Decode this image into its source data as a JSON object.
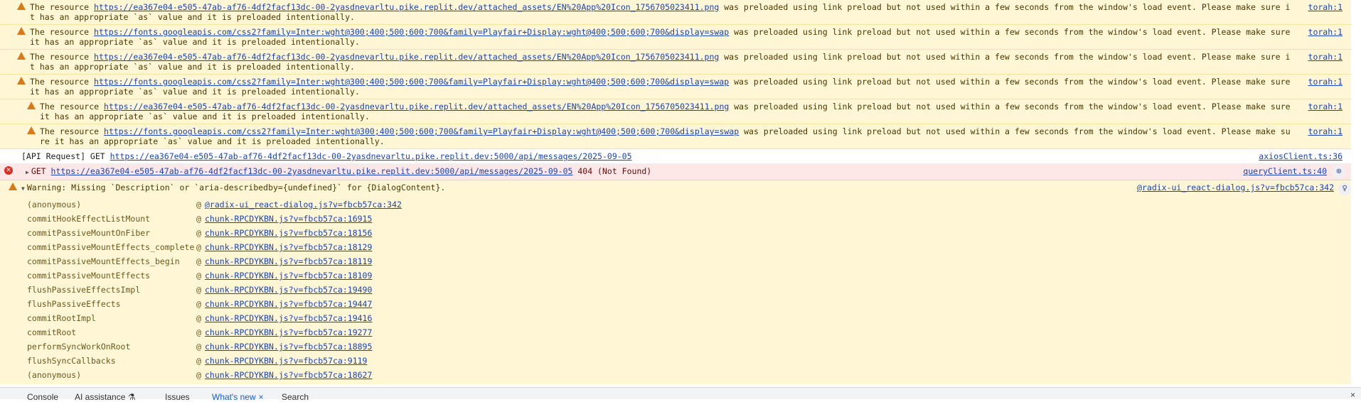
{
  "preload_warnings": [
    {
      "prefix": "The resource ",
      "url": "https://ea367e04-e505-47ab-af76-4df2facf13dc-00-2yasdnevarltu.pike.replit.dev/attached_assets/EN%20App%20Icon_1756705023411.png",
      "suffix": " was preloaded using link preload but not used within a few seconds from the window's load event. Please make sure it has an appropriate `as` value and it is preloaded intentionally.",
      "source": "torah:1",
      "nested": false
    },
    {
      "prefix": "The resource ",
      "url": "https://fonts.googleapis.com/css2?family=Inter:wght@300;400;500;600;700&family=Playfair+Display:wght@400;500;600;700&display=swap",
      "suffix": " was preloaded using link preload but not used within a few seconds from the window's load event. Please make sure it has an appropriate `as` value and it is preloaded intentionally.",
      "source": "torah:1",
      "nested": false
    },
    {
      "prefix": "The resource ",
      "url": "https://ea367e04-e505-47ab-af76-4df2facf13dc-00-2yasdnevarltu.pike.replit.dev/attached_assets/EN%20App%20Icon_1756705023411.png",
      "suffix": " was preloaded using link preload but not used within a few seconds from the window's load event. Please make sure it has an appropriate `as` value and it is preloaded intentionally.",
      "source": "torah:1",
      "nested": false
    },
    {
      "prefix": "The resource ",
      "url": "https://fonts.googleapis.com/css2?family=Inter:wght@300;400;500;600;700&family=Playfair+Display:wght@400;500;600;700&display=swap",
      "suffix": " was preloaded using link preload but not used within a few seconds from the window's load event. Please make sure it has an appropriate `as` value and it is preloaded intentionally.",
      "source": "torah:1",
      "nested": false
    },
    {
      "prefix": "The resource ",
      "url": "https://ea367e04-e505-47ab-af76-4df2facf13dc-00-2yasdnevarltu.pike.replit.dev/attached_assets/EN%20App%20Icon_1756705023411.png",
      "suffix": " was preloaded using link preload but not used within a few seconds from the window's load event. Please make sure it has an appropriate `as` value and it is preloaded intentionally.",
      "source": "torah:1",
      "nested": true
    },
    {
      "prefix": "The resource ",
      "url": "https://fonts.googleapis.com/css2?family=Inter:wght@300;400;500;600;700&family=Playfair+Display:wght@400;500;600;700&display=swap",
      "suffix": " was preloaded using link preload but not used within a few seconds from the window's load event. Please make sure it has an appropriate `as` value and it is preloaded intentionally.",
      "source": "torah:1",
      "nested": true
    }
  ],
  "api_log": {
    "prefix": "[API Request] GET ",
    "url": "https://ea367e04-e505-47ab-af76-4df2facf13dc-00-2yasdnevarltu.pike.replit.dev:5000/api/messages/2025-09-05",
    "source": "axiosClient.ts:36"
  },
  "error_row": {
    "method": "GET ",
    "url": "https://ea367e04-e505-47ab-af76-4df2facf13dc-00-2yasdnevarltu.pike.replit.dev:5000/api/messages/2025-09-05",
    "status": " 404 (Not Found)",
    "source": "queryClient.ts:40",
    "ai_glyph": "⊕"
  },
  "dialog_warning": {
    "text": "Warning: Missing `Description` or `aria-describedby={undefined}` for {DialogContent}.",
    "source": "@radix-ui_react-dialog.js?v=fbcb57ca:342",
    "insight_glyph": "♀"
  },
  "stack_frames": [
    {
      "fn": "(anonymous)",
      "loc": "@radix-ui_react-dialog.js?v=fbcb57ca:342"
    },
    {
      "fn": "commitHookEffectListMount",
      "loc": "chunk-RPCDYKBN.js?v=fbcb57ca:16915"
    },
    {
      "fn": "commitPassiveMountOnFiber",
      "loc": "chunk-RPCDYKBN.js?v=fbcb57ca:18156"
    },
    {
      "fn": "commitPassiveMountEffects_complete",
      "loc": "chunk-RPCDYKBN.js?v=fbcb57ca:18129"
    },
    {
      "fn": "commitPassiveMountEffects_begin",
      "loc": "chunk-RPCDYKBN.js?v=fbcb57ca:18119"
    },
    {
      "fn": "commitPassiveMountEffects",
      "loc": "chunk-RPCDYKBN.js?v=fbcb57ca:18109"
    },
    {
      "fn": "flushPassiveEffectsImpl",
      "loc": "chunk-RPCDYKBN.js?v=fbcb57ca:19490"
    },
    {
      "fn": "flushPassiveEffects",
      "loc": "chunk-RPCDYKBN.js?v=fbcb57ca:19447"
    },
    {
      "fn": "commitRootImpl",
      "loc": "chunk-RPCDYKBN.js?v=fbcb57ca:19416"
    },
    {
      "fn": "commitRoot",
      "loc": "chunk-RPCDYKBN.js?v=fbcb57ca:19277"
    },
    {
      "fn": "performSyncWorkOnRoot",
      "loc": "chunk-RPCDYKBN.js?v=fbcb57ca:18895"
    },
    {
      "fn": "flushSyncCallbacks",
      "loc": "chunk-RPCDYKBN.js?v=fbcb57ca:9119"
    },
    {
      "fn": "(anonymous)",
      "loc": "chunk-RPCDYKBN.js?v=fbcb57ca:18627"
    }
  ],
  "stack_at": "@",
  "drawer": {
    "tabs": [
      {
        "label": "Console",
        "active": false
      },
      {
        "label": "AI assistance ⚗",
        "active": false
      },
      {
        "label": "Issues",
        "active": false
      },
      {
        "label": "What's new",
        "active": true
      },
      {
        "label": "Search",
        "active": false
      }
    ],
    "tab_close": "×",
    "drawer_close": "×"
  },
  "colors": {
    "warning_bg": "#fef6d5",
    "error_bg": "#fde7e7",
    "link": "#1a44b8",
    "warning_icon": "#d8791a",
    "error_icon": "#d93025"
  }
}
